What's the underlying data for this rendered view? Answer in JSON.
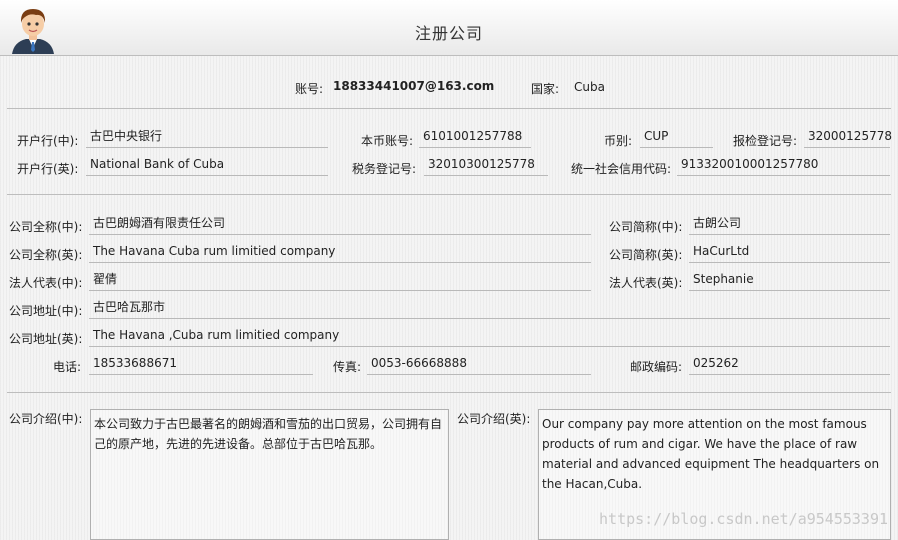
{
  "window": {
    "title": "注册公司"
  },
  "account": {
    "label": "账号:",
    "value": "18833441007@163.com"
  },
  "country": {
    "label": "国家:",
    "value": "Cuba"
  },
  "bank": {
    "cn_label": "开户行(中):",
    "cn_value": "古巴中央银行",
    "local_acct_label": "本币账号:",
    "local_acct_value": "6101001257788",
    "currency_label": "币别:",
    "currency_value": "CUP",
    "inspection_label": "报检登记号:",
    "inspection_value": "32000125778",
    "en_label": "开户行(英):",
    "en_value": "National Bank of Cuba",
    "tax_label": "税务登记号:",
    "tax_value": "32010300125778",
    "credit_label": "统一社会信用代码:",
    "credit_value": "913320010001257780"
  },
  "company": {
    "fullname_cn_label": "公司全称(中):",
    "fullname_cn_value": "古巴朗姆酒有限责任公司",
    "short_cn_label": "公司简称(中):",
    "short_cn_value": "古朗公司",
    "fullname_en_label": "公司全称(英):",
    "fullname_en_value": "The Havana Cuba rum limitied company",
    "short_en_label": "公司简称(英):",
    "short_en_value": "HaCurLtd",
    "rep_cn_label": "法人代表(中):",
    "rep_cn_value": "翟倩",
    "rep_en_label": "法人代表(英):",
    "rep_en_value": "Stephanie",
    "addr_cn_label": "公司地址(中):",
    "addr_cn_value": "古巴哈瓦那市",
    "addr_en_label": "公司地址(英):",
    "addr_en_value": "The Havana ,Cuba rum limitied company",
    "phone_label": "电话:",
    "phone_value": "18533688671",
    "fax_label": "传真:",
    "fax_value": "0053-66668888",
    "zip_label": "邮政编码:",
    "zip_value": "025262"
  },
  "intro": {
    "cn_label": "公司介绍(中):",
    "cn_text": "本公司致力于古巴最著名的朗姆酒和雪茄的出口贸易，公司拥有自己的原产地，先进的先进设备。总部位于古巴哈瓦那。",
    "en_label": "公司介绍(英):",
    "en_text": "Our company pay more attention on the most famous products of  rum and cigar. We have the place of raw material and advanced equipment The headquarters on the Hacan,Cuba."
  },
  "watermark": "https://blog.csdn.net/a954553391"
}
